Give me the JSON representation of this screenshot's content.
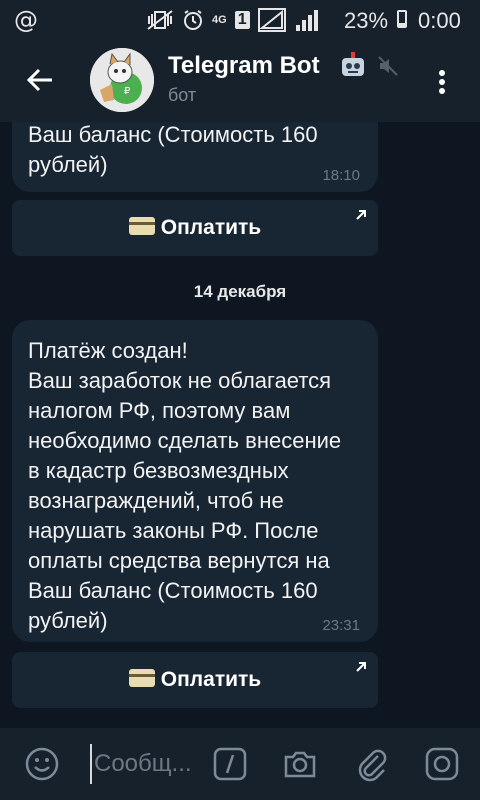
{
  "status_bar": {
    "at_symbol": "@",
    "network": "4G",
    "sim": "1",
    "battery_percent": "23%",
    "battery_level": 0.23,
    "time": "0:00"
  },
  "header": {
    "title": "Telegram Bot",
    "subtitle": "бот",
    "icons": [
      "back-arrow-icon",
      "bot-avatar",
      "robot-emoji-icon",
      "muted-icon",
      "more-vert-icon"
    ]
  },
  "messages": [
    {
      "text": "Ваш баланс (Стоимость 160\nрублей)",
      "time": "18:10",
      "button": "Оплатить"
    },
    {
      "date_separator": "14 декабря"
    },
    {
      "text": "Платёж создан!\nВаш заработок не облагается\nналогом РФ, поэтому вам\nнеобходимо сделать внесение\nв кадастр безвозмездных\nвознаграждений, чтоб не\nнарушать законы РФ. После\nоплаты средства вернутся на\nВаш баланс (Стоимость 160\nрублей)",
      "time": "23:31",
      "button": "Оплатить"
    }
  ],
  "composer": {
    "placeholder": "Сообщ...",
    "icons": [
      "emoji-icon",
      "slash-command-icon",
      "camera-icon",
      "attach-icon",
      "instagram-like-icon"
    ]
  },
  "colors": {
    "bg": "#0e1621",
    "panel": "#17212b",
    "bubble": "#182533",
    "secondary_text": "#7d8b99"
  }
}
